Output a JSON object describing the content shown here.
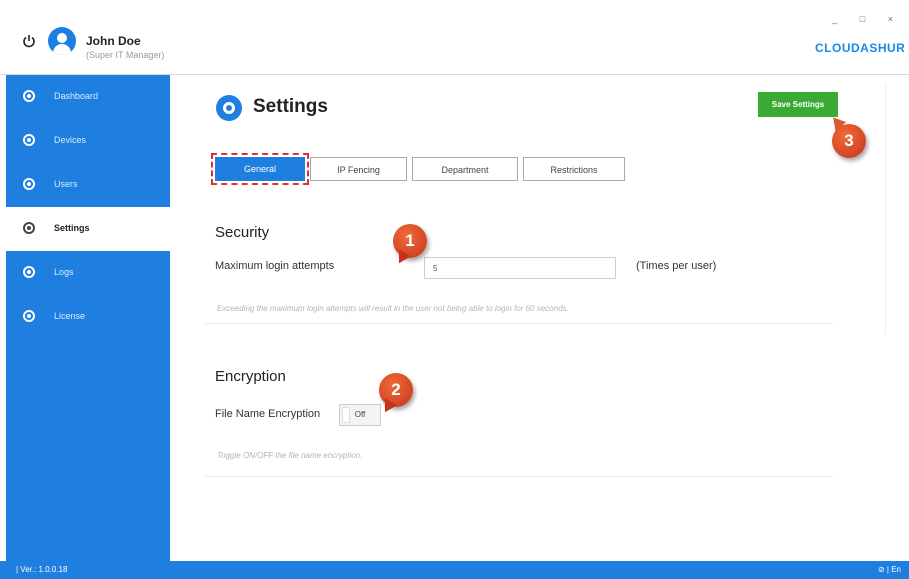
{
  "header": {
    "user_name": "John Doe",
    "user_role": "(Super IT Manager)",
    "brand": "CLOUDASHUR",
    "window_controls": "_ □ ×"
  },
  "sidebar": {
    "items": [
      {
        "label": "Dashboard",
        "icon": "dashboard-icon",
        "active": false
      },
      {
        "label": "Devices",
        "icon": "devices-icon",
        "active": false
      },
      {
        "label": "Users",
        "icon": "users-icon",
        "active": false
      },
      {
        "label": "Settings",
        "icon": "settings-icon",
        "active": true
      },
      {
        "label": "Logs",
        "icon": "logs-icon",
        "active": false
      },
      {
        "label": "License",
        "icon": "license-icon",
        "active": false
      }
    ]
  },
  "footer": {
    "version": "| Ver.: 1.0.0.18",
    "status": "⊘ | En"
  },
  "page": {
    "title": "Settings",
    "save_label": "Save Settings",
    "tabs": [
      {
        "label": "General",
        "active": true
      },
      {
        "label": "IP Fencing",
        "active": false
      },
      {
        "label": "Department",
        "active": false
      },
      {
        "label": "Restrictions",
        "active": false
      }
    ]
  },
  "security": {
    "title": "Security",
    "max_login_label": "Maximum login attempts",
    "max_login_value": "5",
    "unit": "(Times per user)",
    "hint": "Exceeding the maximum login attempts will result in the user not being able to login for 60 seconds."
  },
  "encryption": {
    "title": "Encryption",
    "file_name_label": "File Name Encryption",
    "toggle_value": "Off",
    "hint": "Toggle ON/OFF the file name encryption."
  },
  "callouts": [
    "1",
    "2",
    "3"
  ],
  "colors": {
    "accent": "#1e7fe0",
    "save": "#3aaa35",
    "callout": "#d9441f"
  }
}
